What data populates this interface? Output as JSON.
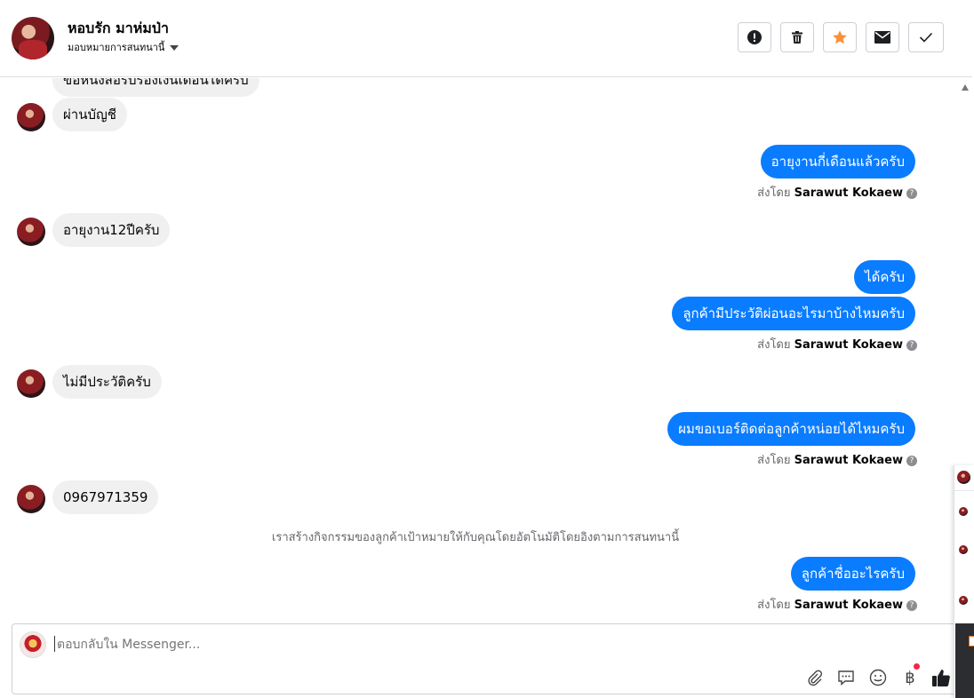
{
  "header": {
    "contact_name": "หอบรัก มาห่มป่า",
    "assign_label": "มอบหมายการสนทนานี้",
    "actions": [
      {
        "icon": "alert-icon"
      },
      {
        "icon": "trash-icon"
      },
      {
        "icon": "star-icon",
        "color": "#f7923b"
      },
      {
        "icon": "mail-icon"
      },
      {
        "icon": "check-icon"
      }
    ]
  },
  "conversation": {
    "partial_message": "ขอหนังสือรับรองเงินเดือนได้ครับ",
    "messages": [
      {
        "dir": "in",
        "text": "ผ่านบัญชี"
      },
      {
        "dir": "out",
        "text": "อายุงานกี่เดือนแล้วครับ"
      },
      {
        "dir": "in",
        "text": "อายุงาน12ปีครับ"
      },
      {
        "dir": "out",
        "text": "ได้ครับ"
      },
      {
        "dir": "out",
        "text": "ลูกค้ามีประวัติผ่อนอะไรมาบ้างไหมครับ"
      },
      {
        "dir": "in",
        "text": "ไม่มีประวัติครับ"
      },
      {
        "dir": "out",
        "text": "ผมขอเบอร์ติดต่อลูกค้าหน่อยได้ไหมครับ"
      },
      {
        "dir": "in",
        "text": "0967971359"
      },
      {
        "dir": "out",
        "text": "ลูกค้าชื่ออะไรครับ"
      }
    ],
    "sent_by_prefix": "ส่งโดย",
    "sent_by_name": "Sarawut Kokaew",
    "system_note": "เราสร้างกิจกรรมของลูกค้าเป้าหมายให้กับคุณโดยอัตโนมัติโดยอิงตามการสนทนานี้"
  },
  "composer": {
    "placeholder": "ตอบกลับใน Messenger...",
    "tools": [
      "paperclip-icon",
      "saved-reply-icon",
      "emoji-icon",
      "baht-icon",
      "thumbs-up-icon"
    ],
    "accent": "#1877f2",
    "badge_color": "#f02849"
  }
}
